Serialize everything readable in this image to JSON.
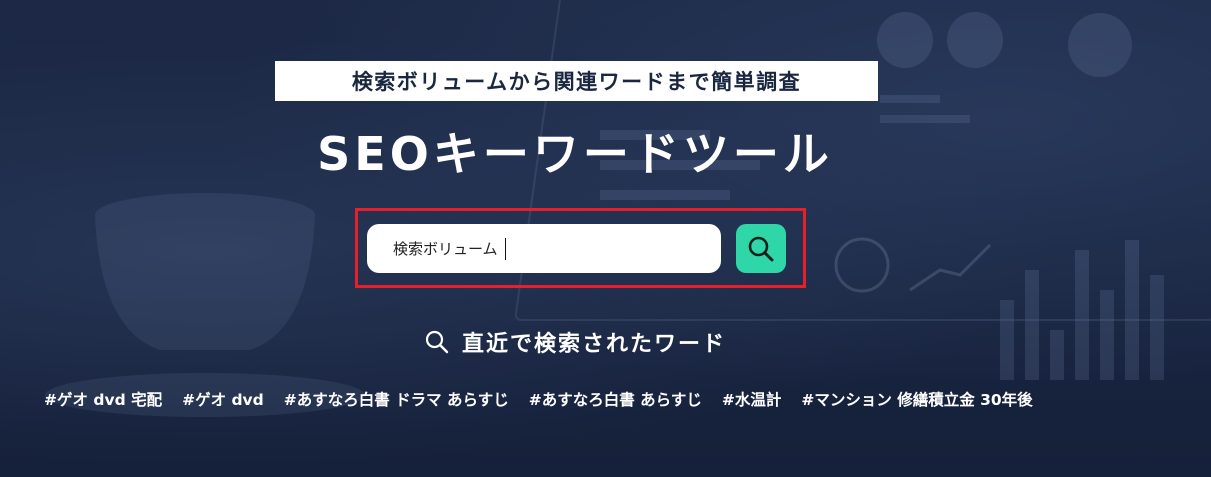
{
  "hero": {
    "tagline": "検索ボリュームから関連ワードまで簡単調査",
    "title": "SEOキーワードツール"
  },
  "search": {
    "value": "検索ボリューム",
    "button_icon": "search-icon",
    "highlight_color": "#e5202a",
    "button_color": "#2fd6a8"
  },
  "recent": {
    "heading": "直近で検索されたワード",
    "icon": "search-icon",
    "tags": [
      "#ゲオ dvd 宅配",
      "#ゲオ dvd",
      "#あすなろ白書 ドラマ あらすじ",
      "#あすなろ白書 あらすじ",
      "#水温計",
      "#マンション 修繕積立金 30年後"
    ]
  },
  "background_color": "#1c2946"
}
